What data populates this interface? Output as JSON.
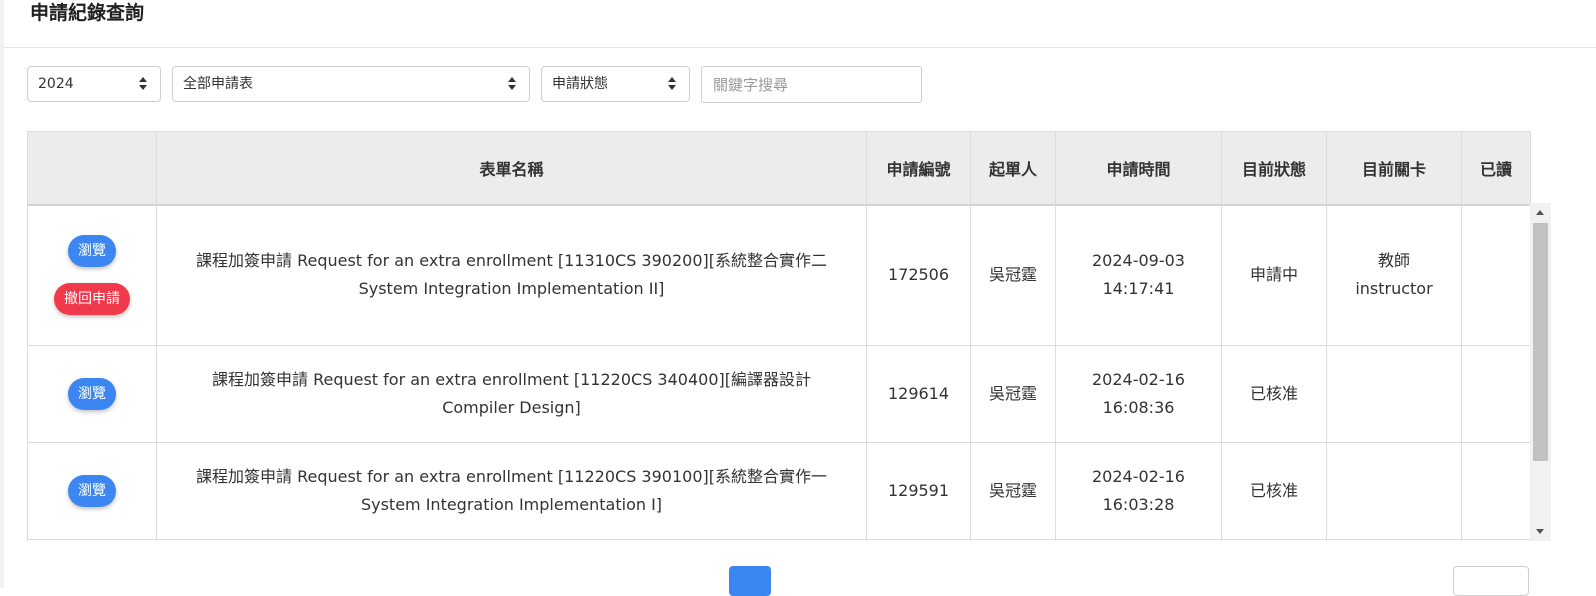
{
  "page": {
    "title": "申請紀錄查詢"
  },
  "filters": {
    "year": "2024",
    "form_type": "全部申請表",
    "status": "申請狀態",
    "search_placeholder": "關鍵字搜尋"
  },
  "table": {
    "headers": [
      "",
      "表單名稱",
      "申請編號",
      "起單人",
      "申請時間",
      "目前狀態",
      "目前關卡",
      "已讀"
    ],
    "view_label": "瀏覽",
    "withdraw_label": "撤回申請",
    "rows": [
      {
        "form_name_line1": "課程加簽申請 Request for an extra enrollment [11310CS 390200][系統整合實作二",
        "form_name_line2": "System Integration Implementation II]",
        "id": "172506",
        "applicant": "吳冠霆",
        "date": "2024-09-03",
        "time": "14:17:41",
        "status": "申請中",
        "stage_line1": "教師",
        "stage_line2": "instructor",
        "read": ""
      },
      {
        "form_name_line1": "課程加簽申請 Request for an extra enrollment [11220CS 340400][編譯器設計",
        "form_name_line2": "Compiler Design]",
        "id": "129614",
        "applicant": "吳冠霆",
        "date": "2024-02-16",
        "time": "16:08:36",
        "status": "已核准",
        "stage_line1": "",
        "stage_line2": "",
        "read": ""
      },
      {
        "form_name_line1": "課程加簽申請 Request for an extra enrollment [11220CS 390100][系統整合實作一",
        "form_name_line2": "System Integration Implementation I]",
        "id": "129591",
        "applicant": "吳冠霆",
        "date": "2024-02-16",
        "time": "16:03:28",
        "status": "已核准",
        "stage_line1": "",
        "stage_line2": "",
        "read": ""
      }
    ]
  },
  "colors": {
    "primary": "#3b86f0",
    "danger": "#f03a4c",
    "header_bg": "#ececec"
  }
}
